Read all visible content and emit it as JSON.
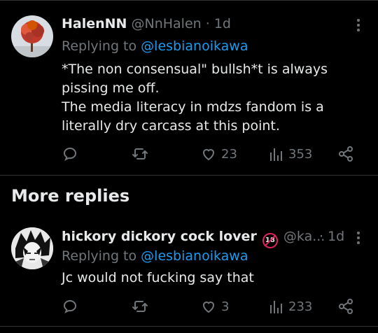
{
  "tweet1": {
    "display_name": "HalenNN",
    "handle": "@NnHalen",
    "time": "· 1d",
    "replying_prefix": "Replying to",
    "replying_to": "@lesbianoikawa",
    "text": "*The non consensual\" bullsh*t is always\npissing me off.\nThe media literacy in mdzs fandom is a\nliterally dry carcass at this point.",
    "likes": "23",
    "views": "353"
  },
  "section": {
    "more_replies": "More replies"
  },
  "tweet2": {
    "display_name": "hickory dickory cock lover",
    "badge_text": "18",
    "handle": "@ka...",
    "time": "· 1d",
    "replying_prefix": "Replying to",
    "replying_to": "@lesbianoikawa",
    "text": "Jc would not fucking say that",
    "likes": "3",
    "views": "233"
  },
  "colors": {
    "background": "#000000",
    "text": "#e7e9ea",
    "muted": "#71767b",
    "link": "#1d9bf0",
    "divider": "#2f3336"
  },
  "icons": [
    "more-icon",
    "reply-icon",
    "retweet-icon",
    "like-icon",
    "views-icon",
    "share-icon"
  ]
}
